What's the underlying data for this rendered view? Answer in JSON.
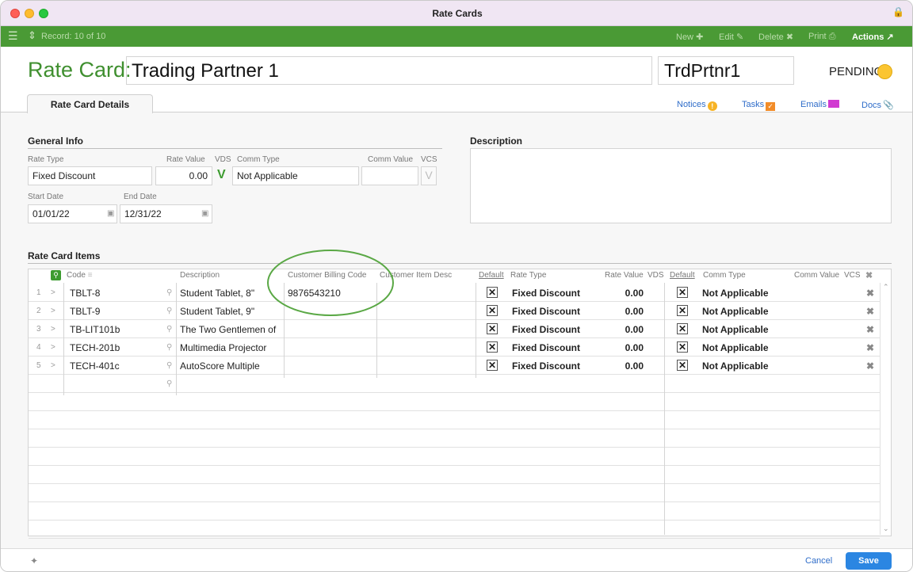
{
  "window": {
    "title": "Rate Cards"
  },
  "toolbar": {
    "record": "Record: 10 of 10",
    "new": "New",
    "edit": "Edit",
    "delete": "Delete",
    "print": "Print",
    "actions": "Actions"
  },
  "header": {
    "label": "Rate Card:",
    "name": "Trading Partner 1",
    "code": "TrdPrtnr1",
    "status": "PENDING"
  },
  "tabs": {
    "details": "Rate Card Details"
  },
  "links": {
    "notices": "Notices",
    "tasks": "Tasks",
    "emails": "Emails",
    "docs": "Docs"
  },
  "general": {
    "title": "General Info",
    "rate_type_label": "Rate Type",
    "rate_type": "Fixed Discount",
    "rate_value_label": "Rate Value",
    "rate_value": "0.00",
    "vds_label": "VDS",
    "vds": "V",
    "comm_type_label": "Comm Type",
    "comm_type": "Not Applicable",
    "comm_value_label": "Comm Value",
    "comm_value": "",
    "vcs_label": "VCS",
    "vcs": "V",
    "start_label": "Start Date",
    "start": "01/01/22",
    "end_label": "End Date",
    "end": "12/31/22"
  },
  "description": {
    "title": "Description",
    "value": ""
  },
  "items": {
    "title": "Rate Card Items",
    "headers": {
      "code": "Code",
      "description": "Description",
      "billing": "Customer Billing Code",
      "item_desc": "Customer Item Desc",
      "default1": "Default",
      "rate_type": "Rate Type",
      "rate_value": "Rate Value",
      "vds": "VDS",
      "default2": "Default",
      "comm_type": "Comm Type",
      "comm_value": "Comm Value",
      "vcs": "VCS"
    },
    "rows": [
      {
        "n": "1",
        "code": "TBLT-8",
        "desc": "Student Tablet, 8\"",
        "billing": "9876543210",
        "rate_type": "Fixed Discount",
        "rate_value": "0.00",
        "comm_type": "Not Applicable"
      },
      {
        "n": "2",
        "code": "TBLT-9",
        "desc": "Student Tablet, 9\"",
        "billing": "",
        "rate_type": "Fixed Discount",
        "rate_value": "0.00",
        "comm_type": "Not Applicable"
      },
      {
        "n": "3",
        "code": "TB-LIT101b",
        "desc": "The Two Gentlemen of",
        "billing": "",
        "rate_type": "Fixed Discount",
        "rate_value": "0.00",
        "comm_type": "Not Applicable"
      },
      {
        "n": "4",
        "code": "TECH-201b",
        "desc": "Multimedia Projector",
        "billing": "",
        "rate_type": "Fixed Discount",
        "rate_value": "0.00",
        "comm_type": "Not Applicable"
      },
      {
        "n": "5",
        "code": "TECH-401c",
        "desc": "AutoScore Multiple",
        "billing": "",
        "rate_type": "Fixed Discount",
        "rate_value": "0.00",
        "comm_type": "Not Applicable"
      }
    ]
  },
  "footer": {
    "cancel": "Cancel",
    "save": "Save"
  },
  "colors": {
    "accent_green": "#4a9a35",
    "status_yellow": "#fbc531",
    "save_blue": "#2b86e2",
    "annotation_green": "#5aa845"
  }
}
